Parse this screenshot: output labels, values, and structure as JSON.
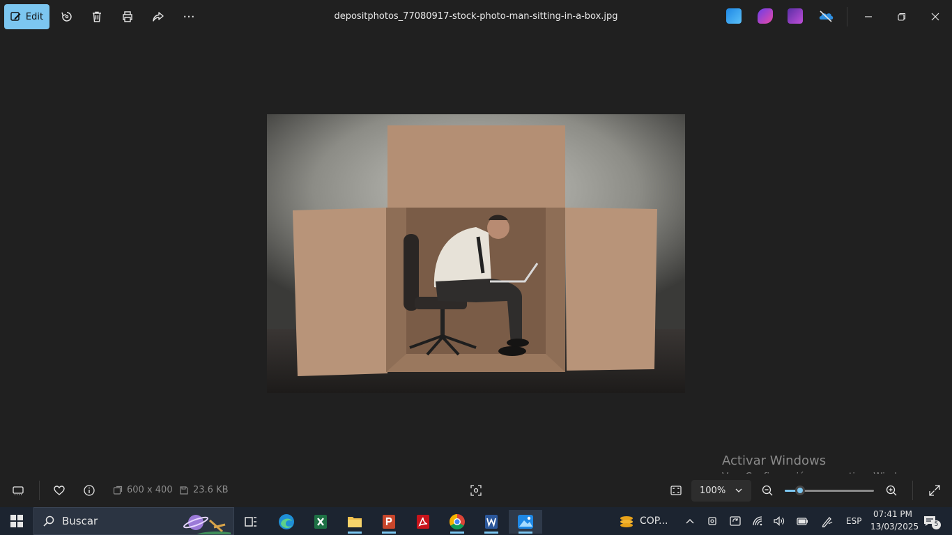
{
  "toolbar": {
    "edit_label": "Edit",
    "title": "depositphotos_77080917-stock-photo-man-sitting-in-a-box.jpg",
    "more_label": "···"
  },
  "watermark": {
    "line1": "Activar Windows",
    "line2": "Ve a Configuración para activar Windows."
  },
  "bottombar": {
    "dimensions": "600 x 400",
    "filesize": "23.6 KB",
    "zoom": "100%",
    "zoom_slider_fraction": 0.17
  },
  "taskbar": {
    "search_placeholder": "Buscar",
    "weather_label": "COP...",
    "language": "ESP",
    "time": "07:41 PM",
    "date": "13/03/2025",
    "notification_count": "5"
  },
  "colors": {
    "accent": "#7cc6f0",
    "background": "#202020",
    "taskbar": "#1c2430"
  }
}
